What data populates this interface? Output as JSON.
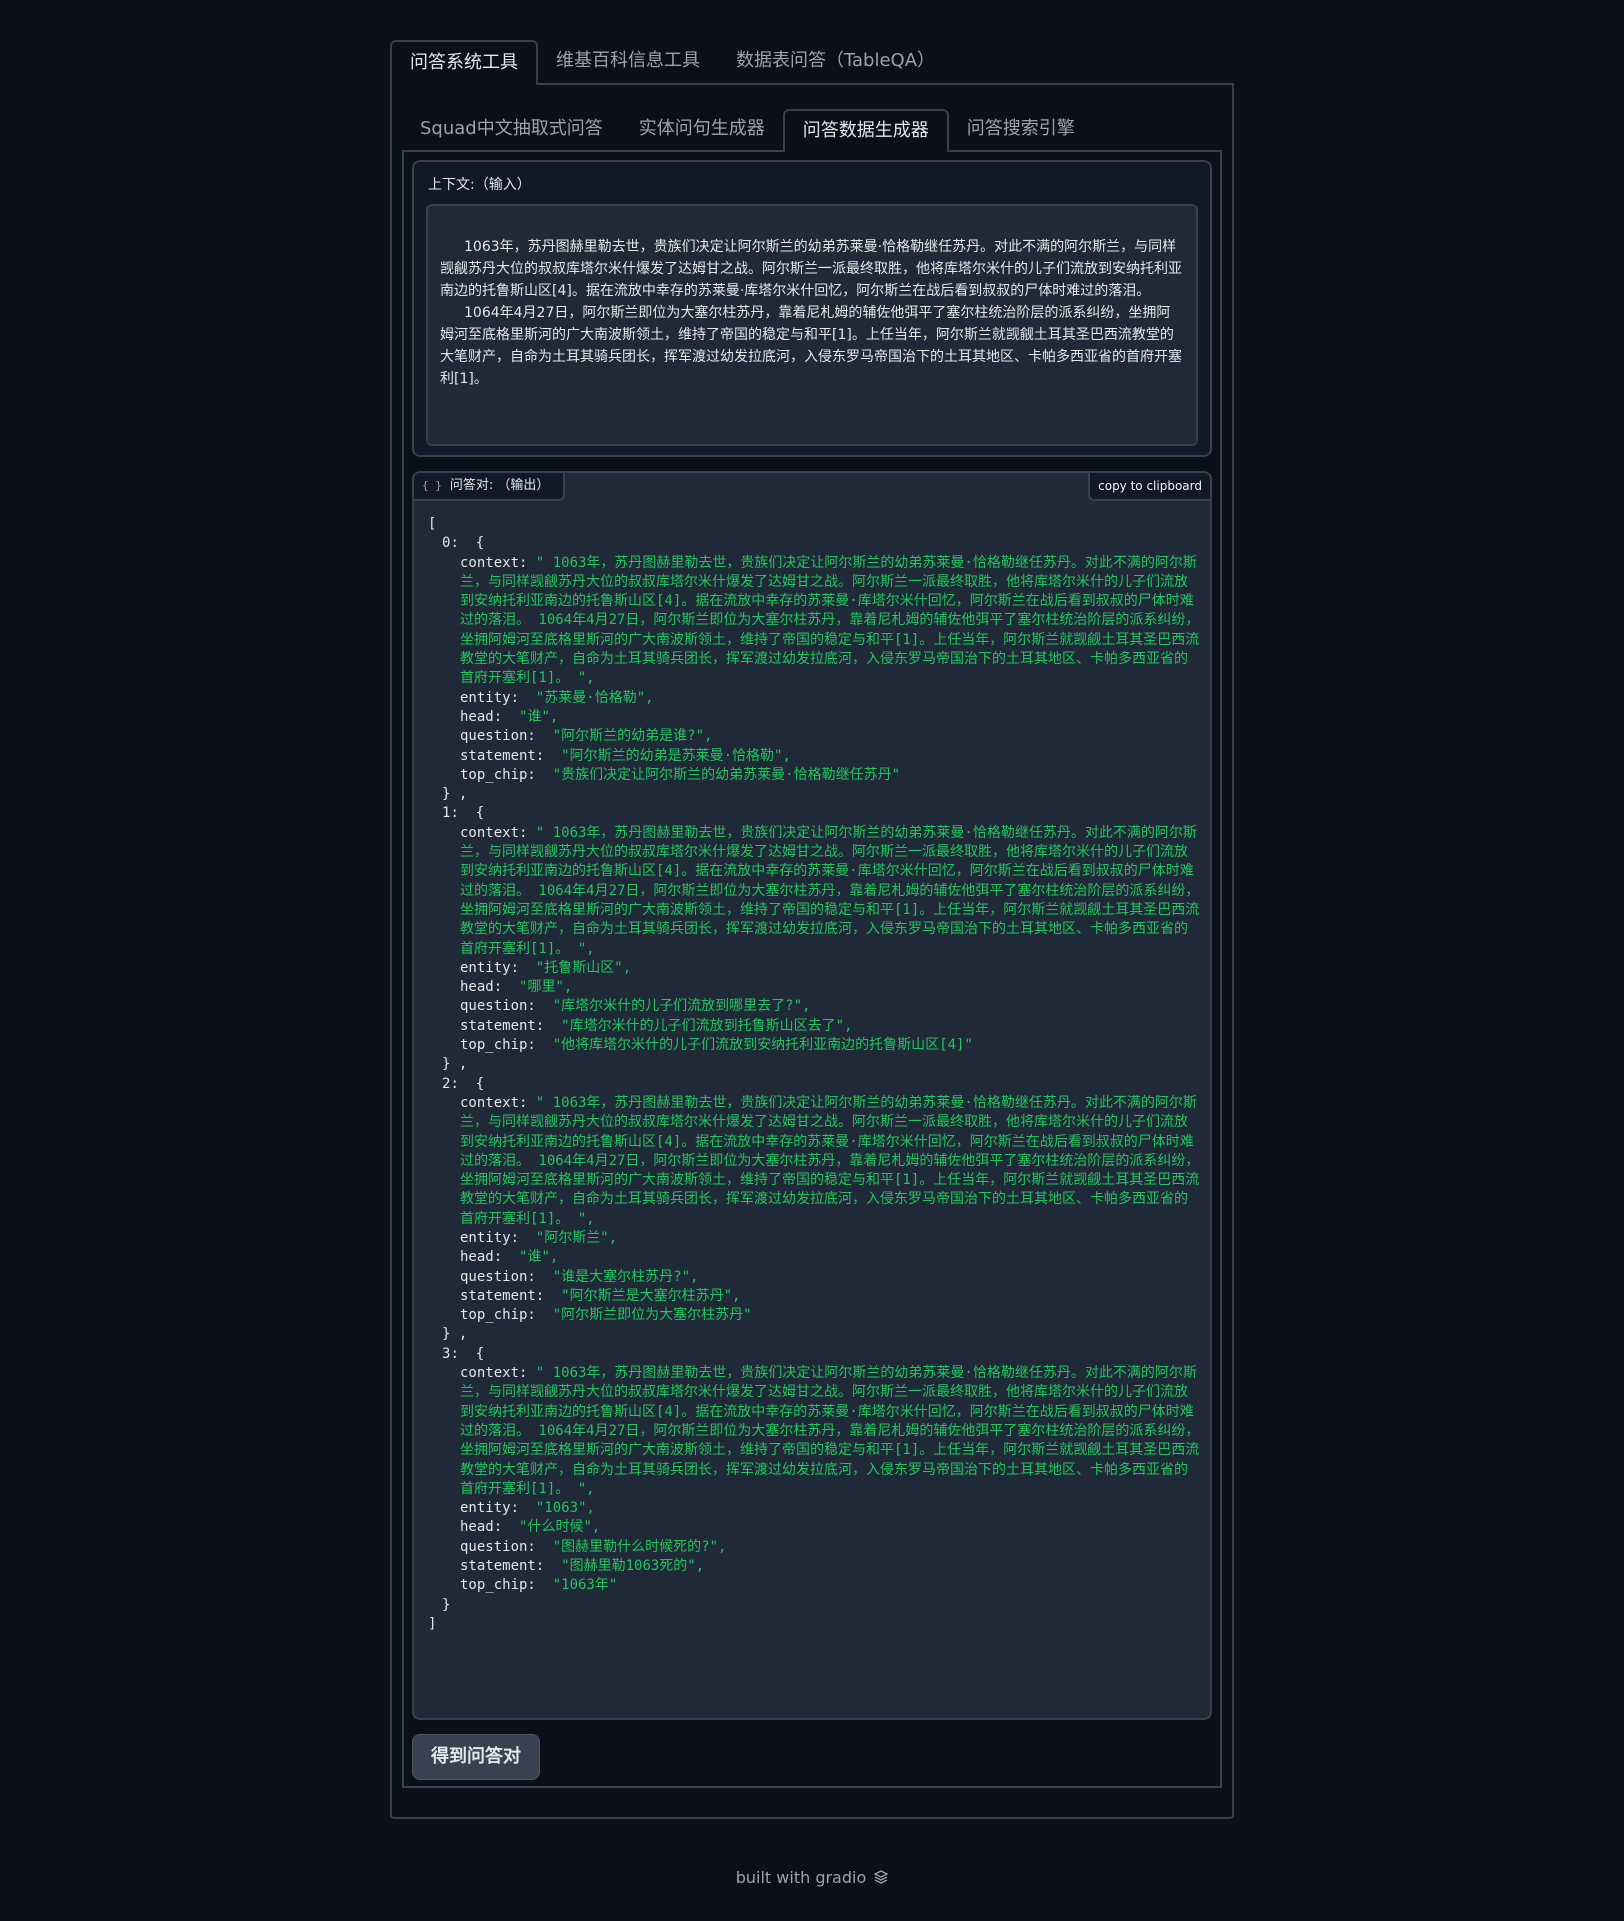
{
  "top_tabs": [
    "问答系统工具",
    "维基百科信息工具",
    "数据表问答（TableQA）"
  ],
  "inner_tabs": [
    "Squad中文抽取式问答",
    "实体问句生成器",
    "问答数据生成器",
    "问答搜索引擎"
  ],
  "context": {
    "label": "上下文:（输入）",
    "paragraphs": [
      "1063年，苏丹图赫里勒去世，贵族们决定让阿尔斯兰的幼弟苏莱曼·恰格勒继任苏丹。对此不满的阿尔斯兰，与同样觊觎苏丹大位的叔叔库塔尔米什爆发了达姆甘之战。阿尔斯兰一派最终取胜，他将库塔尔米什的儿子们流放到安纳托利亚南边的托鲁斯山区[4]。据在流放中幸存的苏莱曼·库塔尔米什回忆，阿尔斯兰在战后看到叔叔的尸体时难过的落泪。",
      "1064年4月27日，阿尔斯兰即位为大塞尔柱苏丹，靠着尼札姆的辅佐他弭平了塞尔柱统治阶层的派系纠纷，坐拥阿姆河至底格里斯河的广大南波斯领土，维持了帝国的稳定与和平[1]。上任当年，阿尔斯兰就觊觎土耳其圣巴西流教堂的大笔财产，自命为土耳其骑兵团长，挥军渡过幼发拉底河，入侵东罗马帝国治下的土耳其地区、卡帕多西亚省的首府开塞利[1]。"
    ]
  },
  "output": {
    "label": "问答对: （输出）",
    "label_icon": "{ }",
    "copy_label": "copy to clipboard",
    "items": [
      {
        "index": "0",
        "context": "\" 1063年，苏丹图赫里勒去世，贵族们决定让阿尔斯兰的幼弟苏莱曼·恰格勒继任苏丹。对此不满的阿尔斯兰，与同样觊觎苏丹大位的叔叔库塔尔米什爆发了达姆甘之战。阿尔斯兰一派最终取胜，他将库塔尔米什的儿子们流放到安纳托利亚南边的托鲁斯山区[4]。据在流放中幸存的苏莱曼·库塔尔米什回忆，阿尔斯兰在战后看到叔叔的尸体时难过的落泪。 1064年4月27日，阿尔斯兰即位为大塞尔柱苏丹，靠着尼札姆的辅佐他弭平了塞尔柱统治阶层的派系纠纷，坐拥阿姆河至底格里斯河的广大南波斯领土，维持了帝国的稳定与和平[1]。上任当年，阿尔斯兰就觊觎土耳其圣巴西流教堂的大笔财产，自命为土耳其骑兵团长，挥军渡过幼发拉底河，入侵东罗马帝国治下的土耳其地区、卡帕多西亚省的首府开塞利[1]。 \",",
        "entity": "\"苏莱曼·恰格勒\",",
        "head": "\"谁\",",
        "question": "\"阿尔斯兰的幼弟是谁?\",",
        "statement": "\"阿尔斯兰的幼弟是苏莱曼·恰格勒\",",
        "top_chip": "\"贵族们决定让阿尔斯兰的幼弟苏莱曼·恰格勒继任苏丹\"",
        "close": "} ,"
      },
      {
        "index": "1",
        "context": "\" 1063年，苏丹图赫里勒去世，贵族们决定让阿尔斯兰的幼弟苏莱曼·恰格勒继任苏丹。对此不满的阿尔斯兰，与同样觊觎苏丹大位的叔叔库塔尔米什爆发了达姆甘之战。阿尔斯兰一派最终取胜，他将库塔尔米什的儿子们流放到安纳托利亚南边的托鲁斯山区[4]。据在流放中幸存的苏莱曼·库塔尔米什回忆，阿尔斯兰在战后看到叔叔的尸体时难过的落泪。 1064年4月27日，阿尔斯兰即位为大塞尔柱苏丹，靠着尼札姆的辅佐他弭平了塞尔柱统治阶层的派系纠纷，坐拥阿姆河至底格里斯河的广大南波斯领土，维持了帝国的稳定与和平[1]。上任当年，阿尔斯兰就觊觎土耳其圣巴西流教堂的大笔财产，自命为土耳其骑兵团长，挥军渡过幼发拉底河，入侵东罗马帝国治下的土耳其地区、卡帕多西亚省的首府开塞利[1]。 \",",
        "entity": "\"托鲁斯山区\",",
        "head": "\"哪里\",",
        "question": "\"库塔尔米什的儿子们流放到哪里去了?\",",
        "statement": "\"库塔尔米什的儿子们流放到托鲁斯山区去了\",",
        "top_chip": "\"他将库塔尔米什的儿子们流放到安纳托利亚南边的托鲁斯山区[4]\"",
        "close": "} ,"
      },
      {
        "index": "2",
        "context": "\" 1063年，苏丹图赫里勒去世，贵族们决定让阿尔斯兰的幼弟苏莱曼·恰格勒继任苏丹。对此不满的阿尔斯兰，与同样觊觎苏丹大位的叔叔库塔尔米什爆发了达姆甘之战。阿尔斯兰一派最终取胜，他将库塔尔米什的儿子们流放到安纳托利亚南边的托鲁斯山区[4]。据在流放中幸存的苏莱曼·库塔尔米什回忆，阿尔斯兰在战后看到叔叔的尸体时难过的落泪。 1064年4月27日，阿尔斯兰即位为大塞尔柱苏丹，靠着尼札姆的辅佐他弭平了塞尔柱统治阶层的派系纠纷，坐拥阿姆河至底格里斯河的广大南波斯领土，维持了帝国的稳定与和平[1]。上任当年，阿尔斯兰就觊觎土耳其圣巴西流教堂的大笔财产，自命为土耳其骑兵团长，挥军渡过幼发拉底河，入侵东罗马帝国治下的土耳其地区、卡帕多西亚省的首府开塞利[1]。 \",",
        "entity": "\"阿尔斯兰\",",
        "head": "\"谁\",",
        "question": "\"谁是大塞尔柱苏丹?\",",
        "statement": "\"阿尔斯兰是大塞尔柱苏丹\",",
        "top_chip": "\"阿尔斯兰即位为大塞尔柱苏丹\"",
        "close": "} ,"
      },
      {
        "index": "3",
        "context": "\" 1063年，苏丹图赫里勒去世，贵族们决定让阿尔斯兰的幼弟苏莱曼·恰格勒继任苏丹。对此不满的阿尔斯兰，与同样觊觎苏丹大位的叔叔库塔尔米什爆发了达姆甘之战。阿尔斯兰一派最终取胜，他将库塔尔米什的儿子们流放到安纳托利亚南边的托鲁斯山区[4]。据在流放中幸存的苏莱曼·库塔尔米什回忆，阿尔斯兰在战后看到叔叔的尸体时难过的落泪。 1064年4月27日，阿尔斯兰即位为大塞尔柱苏丹，靠着尼札姆的辅佐他弭平了塞尔柱统治阶层的派系纠纷，坐拥阿姆河至底格里斯河的广大南波斯领土，维持了帝国的稳定与和平[1]。上任当年，阿尔斯兰就觊觎土耳其圣巴西流教堂的大笔财产，自命为土耳其骑兵团长，挥军渡过幼发拉底河，入侵东罗马帝国治下的土耳其地区、卡帕多西亚省的首府开塞利[1]。 \",",
        "entity": "\"1063\",",
        "head": "\"什么时候\",",
        "question": "\"图赫里勒什么时候死的?\",",
        "statement": "\"图赫里勒1063死的\",",
        "top_chip": "\"1063年\"",
        "close": "}"
      }
    ]
  },
  "submit_label": "得到问答对",
  "footer": {
    "text": "built with gradio",
    "icon": "gradio-logo-icon"
  },
  "colors": {
    "background": "#0b0f19",
    "panel": "#1f2937",
    "border": "#374151",
    "json_string": "#22c55e"
  }
}
